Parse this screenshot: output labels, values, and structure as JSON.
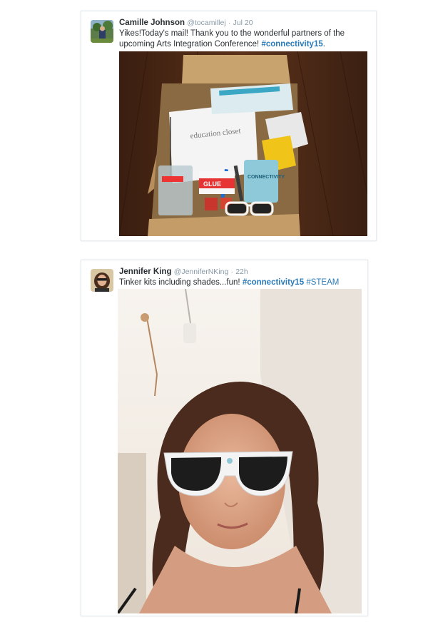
{
  "tweets": [
    {
      "fullname": "Camille Johnson",
      "username": "@tocamillej",
      "separator": "·",
      "time": "Jul 20",
      "text_before": "Yikes!Today's mail! Thank you to the wonderful partners of the upcoming Arts Integration Conference! ",
      "hashtag": "#connectivity15",
      "text_after": ".",
      "media_label_binder": "education closet",
      "media_label_can": "CONNECTIVITY",
      "media_label_glue": "GLUE"
    },
    {
      "fullname": "Jennifer King",
      "username": "@JenniferNKing",
      "separator": "·",
      "time": "22h",
      "text_before": "Tinker kits including shades...fun! ",
      "hashtag": "#connectivity15",
      "hashtag2": "#STEAM"
    }
  ],
  "colors": {
    "link": "#2b7bb9",
    "meta": "#8899a6",
    "text": "#292f33",
    "border": "#e6ecf0"
  },
  "icons": [
    "avatar-camille",
    "avatar-jennifer"
  ]
}
